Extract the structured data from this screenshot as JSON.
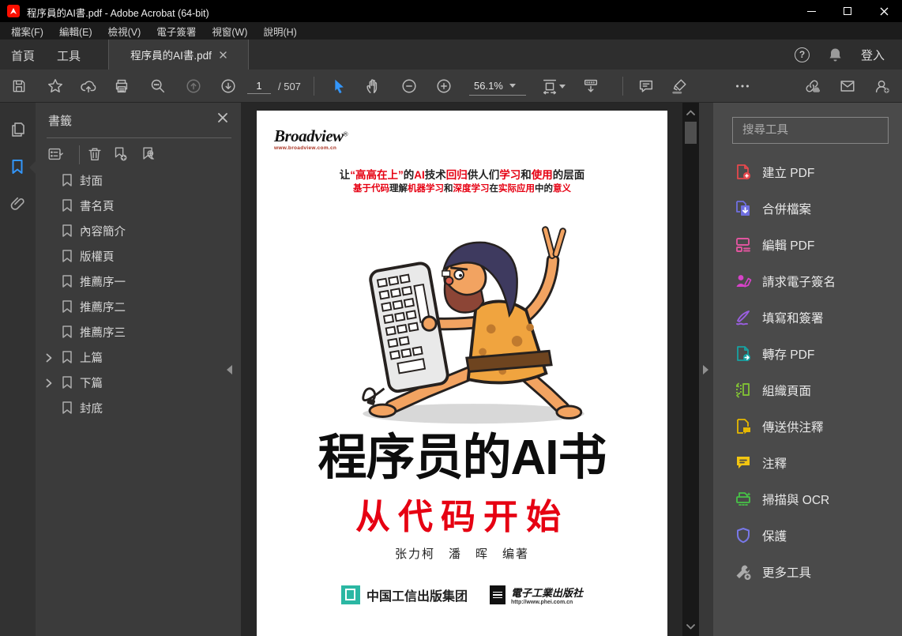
{
  "colors": {
    "accent_blue": "#3396FB",
    "cover_red": "#E60012",
    "acrobat_red": "#FA0F00"
  },
  "window": {
    "title": "程序員的AI書.pdf - Adobe Acrobat (64-bit)"
  },
  "menu": {
    "items": [
      "檔案(F)",
      "編輯(E)",
      "檢視(V)",
      "電子簽署",
      "視窗(W)",
      "說明(H)"
    ]
  },
  "tabbar": {
    "home": "首頁",
    "tools": "工具",
    "document_tab": "程序員的AI書.pdf",
    "sign_in": "登入",
    "help_glyph": "?"
  },
  "toolbar": {
    "page_current": "1",
    "page_total": "/ 507",
    "zoom_value": "56.1%"
  },
  "bookmarks": {
    "title": "書籤",
    "items": [
      {
        "label": "封面",
        "expandable": false
      },
      {
        "label": "書名頁",
        "expandable": false
      },
      {
        "label": "內容簡介",
        "expandable": false
      },
      {
        "label": "版權頁",
        "expandable": false
      },
      {
        "label": "推薦序一",
        "expandable": false
      },
      {
        "label": "推薦序二",
        "expandable": false
      },
      {
        "label": "推薦序三",
        "expandable": false
      },
      {
        "label": "上篇",
        "expandable": true
      },
      {
        "label": "下篇",
        "expandable": true
      },
      {
        "label": "封底",
        "expandable": false
      }
    ]
  },
  "tools_panel": {
    "search_placeholder": "搜尋工具",
    "items": [
      {
        "label": "建立 PDF"
      },
      {
        "label": "合併檔案"
      },
      {
        "label": "編輯 PDF"
      },
      {
        "label": "請求電子簽名"
      },
      {
        "label": "填寫和簽署"
      },
      {
        "label": "轉存 PDF"
      },
      {
        "label": "組織頁面"
      },
      {
        "label": "傳送供注釋"
      },
      {
        "label": "注釋"
      },
      {
        "label": "掃描與 OCR"
      },
      {
        "label": "保護"
      },
      {
        "label": "更多工具"
      }
    ]
  },
  "cover": {
    "brand": "Broadview",
    "brand_reg": "®",
    "brand_url": "www.broadview.com.cn",
    "tagline1": [
      {
        "t": "让",
        "c": "k"
      },
      {
        "t": "“高高在上”",
        "c": "r"
      },
      {
        "t": "的",
        "c": "k"
      },
      {
        "t": "AI",
        "c": "r"
      },
      {
        "t": "技术",
        "c": "k"
      },
      {
        "t": "回归",
        "c": "r"
      },
      {
        "t": "供人们",
        "c": "k"
      },
      {
        "t": "学习",
        "c": "r"
      },
      {
        "t": "和",
        "c": "k"
      },
      {
        "t": "使用",
        "c": "r"
      },
      {
        "t": "的层面",
        "c": "k"
      }
    ],
    "tagline2": [
      {
        "t": "基于代码",
        "c": "r"
      },
      {
        "t": "理解",
        "c": "k"
      },
      {
        "t": "机器学习",
        "c": "r"
      },
      {
        "t": "和",
        "c": "k"
      },
      {
        "t": "深度学习",
        "c": "r"
      },
      {
        "t": "在",
        "c": "k"
      },
      {
        "t": "实际应用",
        "c": "r"
      },
      {
        "t": "中的",
        "c": "k"
      },
      {
        "t": "意义",
        "c": "r"
      }
    ],
    "title": "程序员的AI书",
    "subtitle": "从代码开始",
    "authors": "张力柯　潘　晖　编著",
    "publisher_group": "中国工信出版集团",
    "publisher_house": "電子工業出版社",
    "publisher_url": "http://www.phei.com.cn"
  }
}
